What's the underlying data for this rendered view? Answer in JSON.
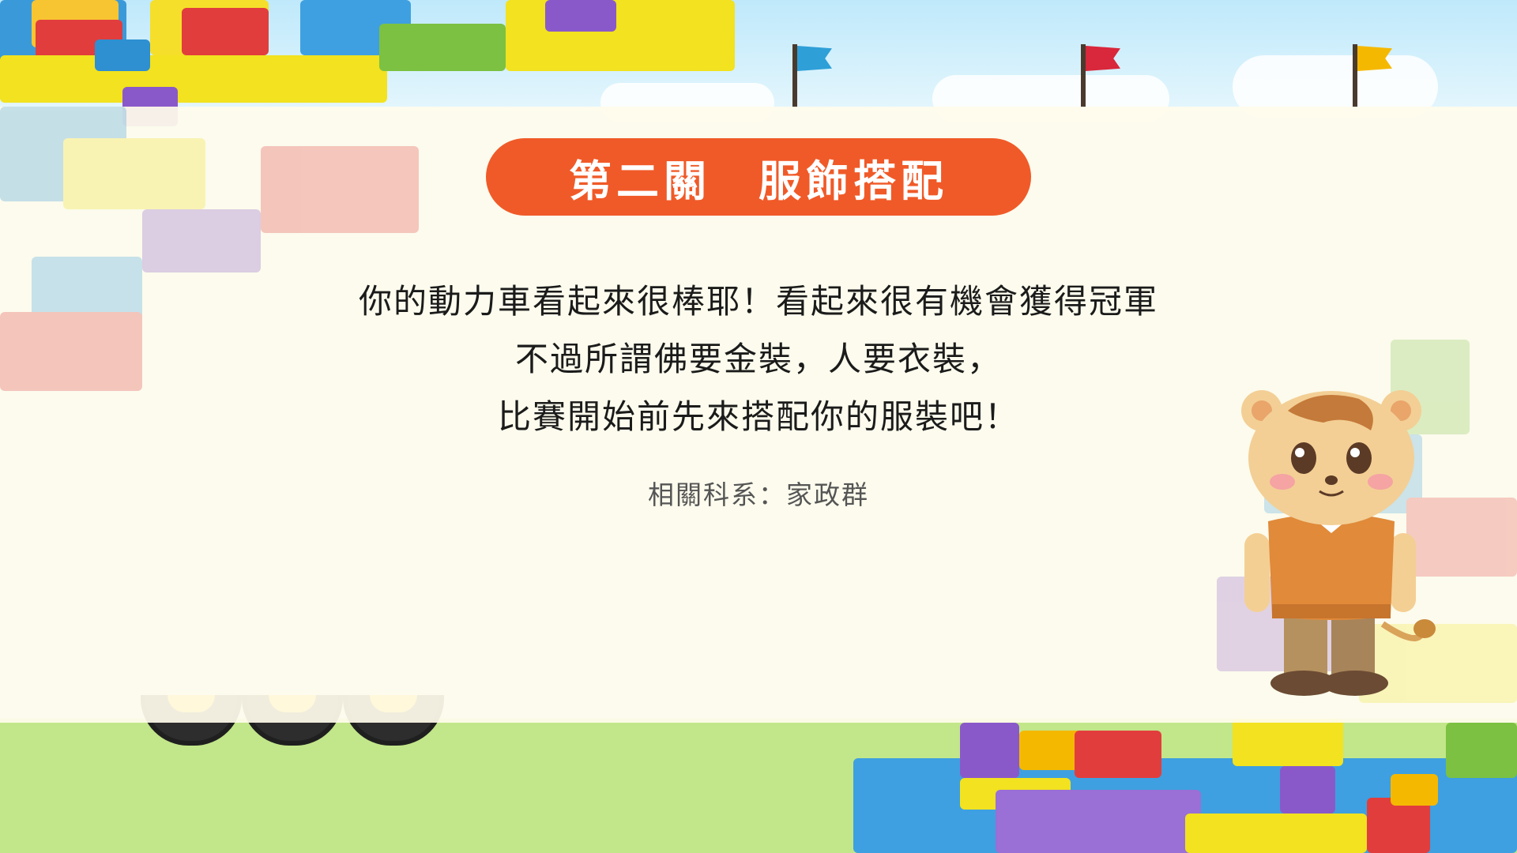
{
  "title": "第二關　服飾搭配",
  "body_lines": [
    "你的動力車看起來很棒耶！看起來很有機會獲得冠軍",
    "不過所謂佛要金裝，人要衣裝，",
    "比賽開始前先來搭配你的服裝吧！"
  ],
  "department_line": "相關科系：家政群",
  "colors": {
    "title_bg": "#f05a28",
    "panel_bg": "#fffcec",
    "grass": "#c2e68a",
    "sky": "#cfeefc",
    "flag_blue": "#2f9fd8",
    "flag_red": "#d9273b",
    "flag_yellow": "#f5b800"
  },
  "icons": {
    "flags": [
      "blue-flag-icon",
      "red-flag-icon",
      "yellow-flag-icon"
    ],
    "mascot": "lion-mascot-icon"
  }
}
